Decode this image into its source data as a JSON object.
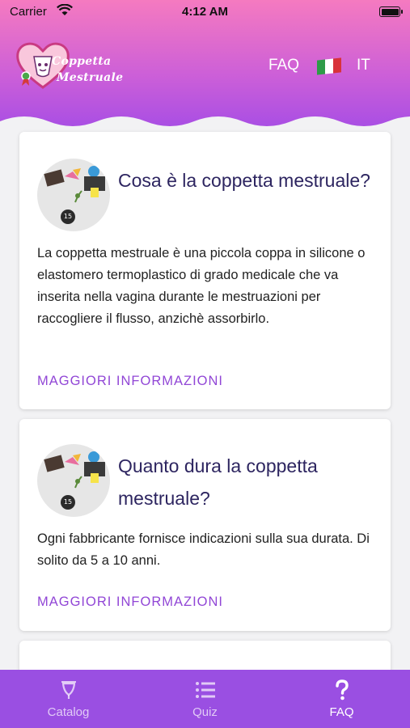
{
  "status_bar": {
    "carrier": "Carrier",
    "time": "4:12 AM"
  },
  "header": {
    "logo_line1": "Coppetta",
    "logo_line2": "Mestruale",
    "nav_faq": "FAQ",
    "language": "IT"
  },
  "cards": [
    {
      "title": "Cosa è la coppetta mestruale?",
      "body": "La coppetta mestruale è una piccola coppa in silicone o elastomero termoplastico di grado medicale che va inserita nella vagina durante le mestruazioni per raccogliere il flusso, anzichè assorbirlo.",
      "link": "MAGGIORI INFORMAZIONI"
    },
    {
      "title": "Quanto dura la coppetta mestruale?",
      "body": "Ogni fabbricante fornisce indicazioni sulla sua durata. Di solito da 5 a 10 anni.",
      "link": "MAGGIORI INFORMAZIONI"
    }
  ],
  "tabbar": {
    "tabs": [
      {
        "label": "Catalog",
        "icon": "cup-icon"
      },
      {
        "label": "Quiz",
        "icon": "list-icon"
      },
      {
        "label": "FAQ",
        "icon": "question-icon",
        "active": true
      }
    ]
  }
}
